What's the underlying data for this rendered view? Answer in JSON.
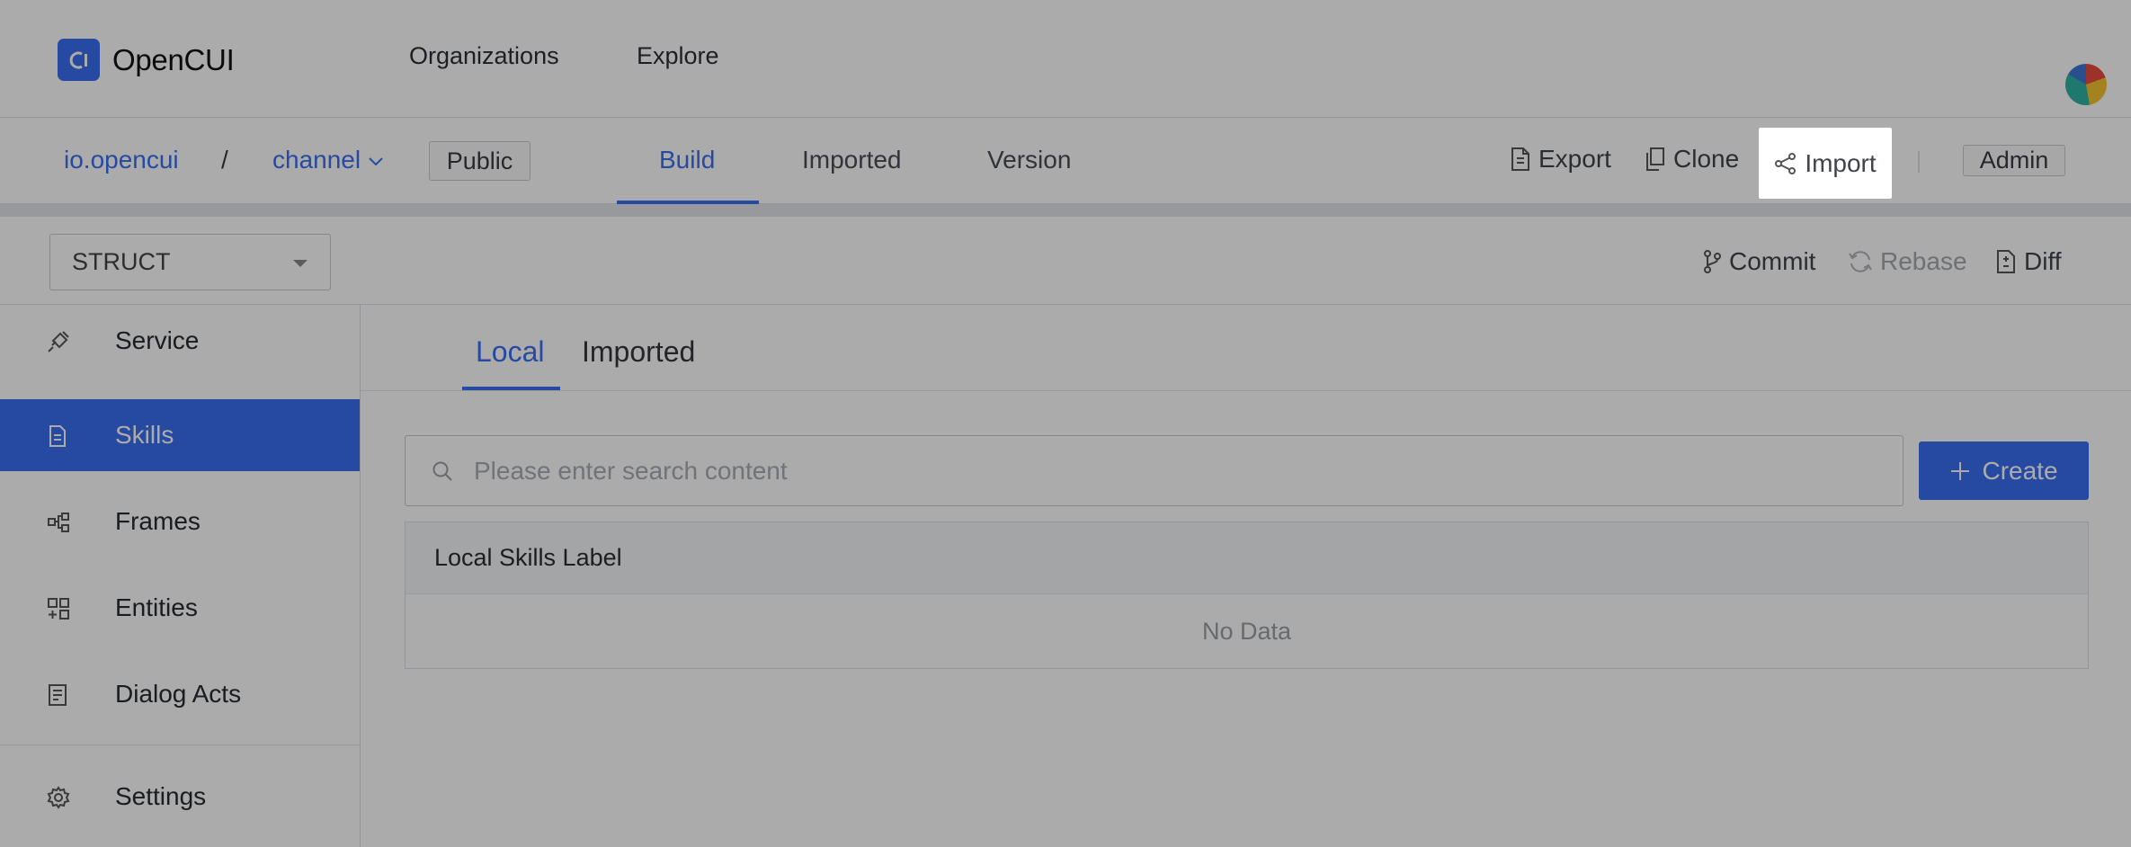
{
  "app": {
    "name": "OpenCUI"
  },
  "top_nav": {
    "items": [
      "Organizations",
      "Explore"
    ]
  },
  "breadcrumb": {
    "org": "io.opencui",
    "separator": "/",
    "project": "channel",
    "visibility_tag": "Public"
  },
  "project_tabs": {
    "items": [
      "Build",
      "Imported",
      "Version"
    ],
    "active": "Build"
  },
  "project_actions": {
    "export": "Export",
    "clone": "Clone",
    "import": "Import",
    "admin": "Admin"
  },
  "toolbar": {
    "select_value": "STRUCT",
    "commit": "Commit",
    "rebase": "Rebase",
    "diff": "Diff"
  },
  "sidebar": {
    "items": [
      {
        "label": "Service",
        "icon": "plug-icon"
      },
      {
        "label": "Skills",
        "icon": "document-icon",
        "active": true
      },
      {
        "label": "Frames",
        "icon": "hierarchy-icon"
      },
      {
        "label": "Entities",
        "icon": "grid-plus-icon"
      },
      {
        "label": "Dialog Acts",
        "icon": "list-doc-icon"
      }
    ],
    "settings": "Settings"
  },
  "content": {
    "tabs": [
      "Local",
      "Imported"
    ],
    "active_tab": "Local",
    "search_placeholder": "Please enter search content",
    "create_button": "Create",
    "table": {
      "header": "Local Skills Label",
      "empty_text": "No Data"
    }
  },
  "colors": {
    "brand": "#3a6ff2",
    "overlay": "rgba(0,0,0,0.33)"
  }
}
